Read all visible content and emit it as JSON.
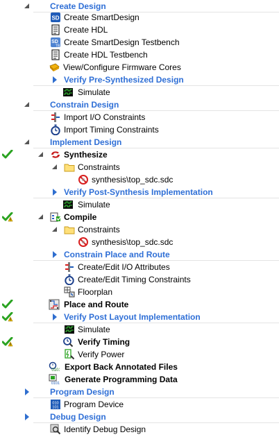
{
  "rows": [
    {
      "label": "Create Design",
      "style": "cat",
      "expander": "down",
      "icon": null,
      "status": null
    },
    {
      "label": "Create SmartDesign",
      "style": "normal",
      "expander": null,
      "icon": "smartdesign-icon",
      "status": null
    },
    {
      "label": "Create HDL",
      "style": "normal",
      "expander": null,
      "icon": "hdl-file-icon",
      "status": null
    },
    {
      "label": "Create SmartDesign Testbench",
      "style": "normal",
      "expander": null,
      "icon": "smartdesign-testbench-icon",
      "status": null
    },
    {
      "label": "Create HDL Testbench",
      "style": "normal",
      "expander": null,
      "icon": "hdl-file-icon",
      "status": null
    },
    {
      "label": "View/Configure Firmware Cores",
      "style": "normal",
      "expander": null,
      "icon": "firmware-cores-icon",
      "status": null
    },
    {
      "label": "Verify Pre-Synthesized Design",
      "style": "cat",
      "expander": "right",
      "icon": null,
      "status": null
    },
    {
      "label": "Simulate",
      "style": "normal",
      "expander": null,
      "icon": "simulate-icon",
      "status": null
    },
    {
      "label": "Constrain Design",
      "style": "cat",
      "expander": "down",
      "icon": null,
      "status": null
    },
    {
      "label": "Import I/O Constraints",
      "style": "normal",
      "expander": null,
      "icon": "io-constraints-icon",
      "status": null
    },
    {
      "label": "Import Timing Constraints",
      "style": "normal",
      "expander": null,
      "icon": "stopwatch-icon",
      "status": null
    },
    {
      "label": "Implement Design",
      "style": "cat",
      "expander": "down",
      "icon": null,
      "status": null
    },
    {
      "label": "Synthesize",
      "style": "bold",
      "expander": "down",
      "icon": "synthesize-icon",
      "status": "check"
    },
    {
      "label": "Constraints",
      "style": "normal",
      "expander": "down",
      "icon": "folder-icon",
      "status": null
    },
    {
      "label": "synthesis\\top_sdc.sdc",
      "style": "normal",
      "expander": null,
      "icon": "sdc-file-icon",
      "status": null
    },
    {
      "label": "Verify Post-Synthesis Implementation",
      "style": "cat",
      "expander": "right",
      "icon": null,
      "status": null
    },
    {
      "label": "Simulate",
      "style": "normal",
      "expander": null,
      "icon": "simulate-icon",
      "status": null
    },
    {
      "label": "Compile",
      "style": "bold",
      "expander": "down",
      "icon": "compile-icon",
      "status": "check-warning"
    },
    {
      "label": "Constraints",
      "style": "normal",
      "expander": "down",
      "icon": "folder-icon",
      "status": null
    },
    {
      "label": "synthesis\\top_sdc.sdc",
      "style": "normal",
      "expander": null,
      "icon": "sdc-file-icon",
      "status": null
    },
    {
      "label": "Constrain Place and Route",
      "style": "cat",
      "expander": "right",
      "icon": null,
      "status": null
    },
    {
      "label": "Create/Edit I/O Attributes",
      "style": "normal",
      "expander": null,
      "icon": "io-constraints-icon",
      "status": null
    },
    {
      "label": "Create/Edit Timing Constraints",
      "style": "normal",
      "expander": null,
      "icon": "stopwatch-icon",
      "status": null
    },
    {
      "label": "Floorplan",
      "style": "normal",
      "expander": null,
      "icon": "floorplan-icon",
      "status": null
    },
    {
      "label": "Place and Route",
      "style": "bold",
      "expander": null,
      "icon": "place-route-icon",
      "status": "check"
    },
    {
      "label": "Verify Post Layout Implementation",
      "style": "cat",
      "expander": "right",
      "icon": null,
      "status": "check-warning"
    },
    {
      "label": "Simulate",
      "style": "normal",
      "expander": null,
      "icon": "simulate-icon",
      "status": null
    },
    {
      "label": "Verify Timing",
      "style": "bold",
      "expander": null,
      "icon": "verify-timing-icon",
      "status": "check-warning"
    },
    {
      "label": "Verify Power",
      "style": "normal",
      "expander": null,
      "icon": "verify-power-icon",
      "status": null
    },
    {
      "label": "Export Back Annotated Files",
      "style": "bold",
      "expander": null,
      "icon": "export-files-icon",
      "status": null
    },
    {
      "label": "Generate Programming Data",
      "style": "bold",
      "expander": null,
      "icon": "programming-data-icon",
      "status": null
    },
    {
      "label": "Program Design",
      "style": "cat",
      "expander": "right",
      "icon": null,
      "status": null
    },
    {
      "label": "Program Device",
      "style": "normal",
      "expander": null,
      "icon": "program-device-icon",
      "status": null
    },
    {
      "label": "Debug Design",
      "style": "cat",
      "expander": "right",
      "icon": null,
      "status": null
    },
    {
      "label": "Identify Debug Design",
      "style": "normal",
      "expander": null,
      "icon": "identify-debug-icon",
      "status": null
    }
  ],
  "colors": {
    "category": "#2f6fd6",
    "check": "#2aa321",
    "warning": "#f2c200"
  }
}
